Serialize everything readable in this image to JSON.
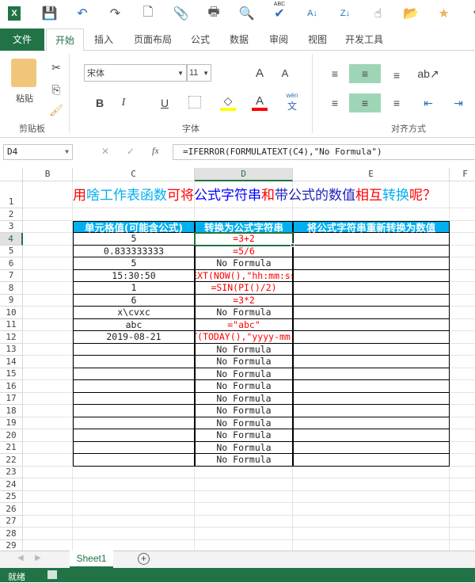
{
  "qat": {
    "icons": [
      "excel-logo-icon",
      "save-icon",
      "undo-icon",
      "redo-icon",
      "new-file-icon",
      "attach-icon",
      "print-icon",
      "print-preview-icon",
      "spell-check-icon",
      "sort-ascending-icon",
      "sort-descending-icon",
      "touch-mode-icon",
      "open-folder-icon",
      "favorites-folder-icon",
      "customize-icon"
    ],
    "spell_label": "ABC"
  },
  "tabs": [
    "文件",
    "开始",
    "插入",
    "页面布局",
    "公式",
    "数据",
    "审阅",
    "视图",
    "开发工具"
  ],
  "ribbon": {
    "paste": "粘贴",
    "clipboard_group": "剪贴板",
    "font_name": "宋体",
    "font_size": "11",
    "font_group": "字体",
    "bold": "B",
    "italic": "I",
    "underline": "U",
    "font_color_glyph": "A",
    "grow_glyph": "A",
    "shrink_glyph": "A",
    "phonetic": "wén",
    "phonetic_char": "文",
    "align_group": "对齐方式",
    "colors": {
      "highlight": "#ffff00",
      "font": "#ff0000",
      "selected": "#9fd5b7"
    }
  },
  "formula_bar": {
    "name_box": "D4",
    "fx": "fx",
    "formula": "=IFERROR(FORMULATEXT(C4),\"No Formula\")"
  },
  "columns": [
    "B",
    "C",
    "D",
    "E",
    "F"
  ],
  "rows": [
    "1",
    "2",
    "3",
    "4",
    "5",
    "6",
    "7",
    "8",
    "9",
    "10",
    "11",
    "12",
    "13",
    "14",
    "15",
    "16",
    "17",
    "18",
    "19",
    "20",
    "21",
    "22",
    "23",
    "24",
    "25",
    "26",
    "27",
    "28",
    "29"
  ],
  "title": [
    {
      "t": "用",
      "c": "#ff0000"
    },
    {
      "t": "啥工作表函数",
      "c": "#00b0f0"
    },
    {
      "t": "可将",
      "c": "#ff0000"
    },
    {
      "t": "公式字符串",
      "c": "#0000ff"
    },
    {
      "t": "和",
      "c": "#ff0000"
    },
    {
      "t": "带公式的数值",
      "c": "#2020c0"
    },
    {
      "t": "相互",
      "c": "#ff0000"
    },
    {
      "t": "转换",
      "c": "#00b0f0"
    },
    {
      "t": "呢？",
      "c": "#ff0000"
    }
  ],
  "table": {
    "headers": [
      "单元格值(可能含公式)",
      "转换为公式字符串",
      "将公式字符串重新转换为数值"
    ],
    "header_bg": "#00b0f0",
    "rows": [
      [
        "5",
        "=3+2"
      ],
      [
        "0.833333333",
        "=5/6"
      ],
      [
        "5",
        "No Formula"
      ],
      [
        "15:30:50",
        "=TEXT(NOW(),\"hh:mm:ss\")"
      ],
      [
        "1",
        "=SIN(PI()/2)"
      ],
      [
        "6",
        "=3*2"
      ],
      [
        "x\\cvxc",
        "No Formula"
      ],
      [
        "abc",
        "=\"abc\""
      ],
      [
        "2019-08-21",
        "=TEXT(TODAY(),\"yyyy-mm-dd\")"
      ],
      [
        "",
        "No Formula"
      ],
      [
        "",
        "No Formula"
      ],
      [
        "",
        "No Formula"
      ],
      [
        "",
        "No Formula"
      ],
      [
        "",
        "No Formula"
      ],
      [
        "",
        "No Formula"
      ],
      [
        "",
        "No Formula"
      ],
      [
        "",
        "No Formula"
      ],
      [
        "",
        "No Formula"
      ],
      [
        "",
        "No Formula"
      ]
    ]
  },
  "sheet_tabs": [
    "Sheet1"
  ],
  "status": {
    "ready": "就绪",
    "bg": "#217346"
  }
}
